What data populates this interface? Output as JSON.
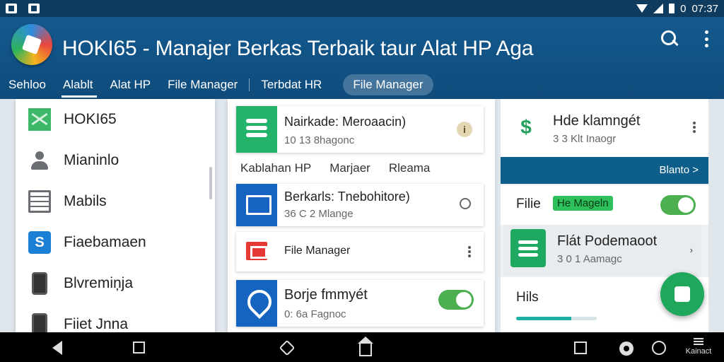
{
  "status_bar": {
    "time": "07:37",
    "battery_label": "0"
  },
  "app": {
    "title": "HOKI65 - Manajer Berkas Terbaik taur Alat HP Aga"
  },
  "tabs": [
    {
      "label": "Sehloo",
      "active": false
    },
    {
      "label": "Alablt",
      "active": true
    },
    {
      "label": "Alat HP",
      "active": false
    },
    {
      "label": "File Manager",
      "active": false
    },
    {
      "label": "Terbdat HR",
      "active": false
    },
    {
      "label": "File Manager",
      "active": false,
      "chip": true
    }
  ],
  "drawer": {
    "items": [
      {
        "label": "HOKI65",
        "icon": "mail-icon"
      },
      {
        "label": "Mianinlo",
        "icon": "person-icon"
      },
      {
        "label": "Mabils",
        "icon": "list-icon"
      },
      {
        "label": "Fiaebamaen",
        "icon": "app-icon",
        "icon_glyph": "S"
      },
      {
        "label": "Blvremiņja",
        "icon": "phone-icon"
      },
      {
        "label": "Fiiet Jnna",
        "icon": "phone-icon"
      }
    ]
  },
  "middle": {
    "card1": {
      "title": "Nairkade: Meroaacin)",
      "subtitle": "10 13 8hagonc",
      "badge": "i"
    },
    "sub_tabs": [
      "Kablahan HP",
      "Marjaer",
      "Rleama"
    ],
    "card2": {
      "title": "Berkarls: Tnebohitore)",
      "subtitle": "36 C 2 Mlange"
    },
    "card3": {
      "title": "File Manager"
    },
    "card4": {
      "title": "Borje fmmyét",
      "subtitle": "0: 6a Fagnoc",
      "toggle_on": true
    }
  },
  "right": {
    "header": {
      "title": "Hde klamngét",
      "subtitle": "3 3 Klt Inaogr"
    },
    "band_label": "Blanto >",
    "row": {
      "label": "Filie",
      "tag": "He Mageln",
      "toggle_on": true
    },
    "card": {
      "title": "Flát Podemaoot",
      "subtitle": "3 0 1 Aamagc",
      "chevron": "›"
    },
    "bottom": {
      "label": "Hils",
      "progress": 0.68
    }
  },
  "navbar": {
    "menu_label": "Kainact"
  },
  "colors": {
    "app_bar": "#14598e",
    "accent_green": "#23b36b",
    "accent_blue": "#1565c0",
    "band": "#0e5e8b"
  }
}
